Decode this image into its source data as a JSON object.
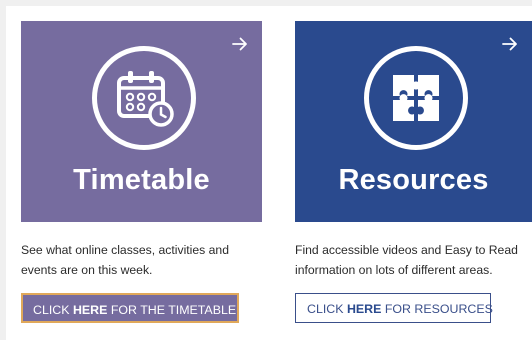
{
  "cards": [
    {
      "title": "Timetable",
      "description": "See what online classes, activities and events are on this week.",
      "button": {
        "prefix": "CLICK ",
        "emphasis": "HERE",
        "suffix": " FOR THE TIMETABLE"
      },
      "icon": "calendar-clock-icon",
      "color": "#766c9f"
    },
    {
      "title": "Resources",
      "description": "Find accessible videos and Easy to Read information on lots of different areas.",
      "button": {
        "prefix": "CLICK ",
        "emphasis": "HERE",
        "suffix": " FOR RESOURCES"
      },
      "icon": "puzzle-icon",
      "color": "#2a4a8e"
    }
  ],
  "colors": {
    "button_border_accent": "#e0a85a",
    "text": "#2b2b2b"
  }
}
